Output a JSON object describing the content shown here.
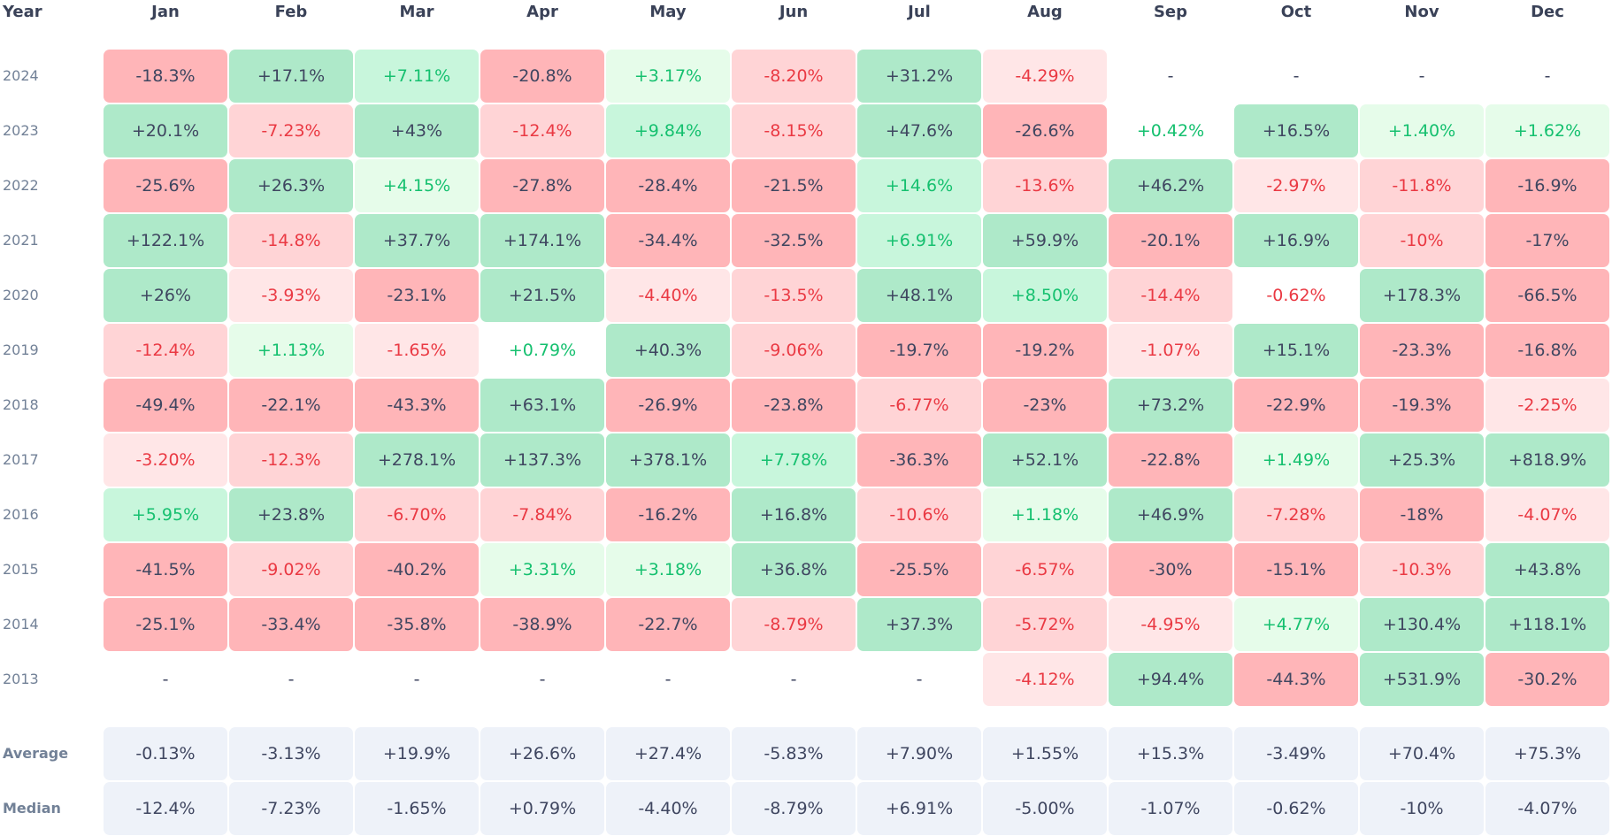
{
  "chart_data": {
    "type": "heatmap",
    "title": "",
    "row_header": "Year",
    "columns": [
      "Jan",
      "Feb",
      "Mar",
      "Apr",
      "May",
      "Jun",
      "Jul",
      "Aug",
      "Sep",
      "Oct",
      "Nov",
      "Dec"
    ],
    "rows": [
      {
        "label": "2024",
        "values": [
          "-18.3%",
          "+17.1%",
          "+7.11%",
          "-20.8%",
          "+3.17%",
          "-8.20%",
          "+31.2%",
          "-4.29%",
          "-",
          "-",
          "-",
          "-"
        ]
      },
      {
        "label": "2023",
        "values": [
          "+20.1%",
          "-7.23%",
          "+43%",
          "-12.4%",
          "+9.84%",
          "-8.15%",
          "+47.6%",
          "-26.6%",
          "+0.42%",
          "+16.5%",
          "+1.40%",
          "+1.62%"
        ]
      },
      {
        "label": "2022",
        "values": [
          "-25.6%",
          "+26.3%",
          "+4.15%",
          "-27.8%",
          "-28.4%",
          "-21.5%",
          "+14.6%",
          "-13.6%",
          "+46.2%",
          "-2.97%",
          "-11.8%",
          "-16.9%"
        ]
      },
      {
        "label": "2021",
        "values": [
          "+122.1%",
          "-14.8%",
          "+37.7%",
          "+174.1%",
          "-34.4%",
          "-32.5%",
          "+6.91%",
          "+59.9%",
          "-20.1%",
          "+16.9%",
          "-10%",
          "-17%"
        ]
      },
      {
        "label": "2020",
        "values": [
          "+26%",
          "-3.93%",
          "-23.1%",
          "+21.5%",
          "-4.40%",
          "-13.5%",
          "+48.1%",
          "+8.50%",
          "-14.4%",
          "-0.62%",
          "+178.3%",
          "-66.5%"
        ]
      },
      {
        "label": "2019",
        "values": [
          "-12.4%",
          "+1.13%",
          "-1.65%",
          "+0.79%",
          "+40.3%",
          "-9.06%",
          "-19.7%",
          "-19.2%",
          "-1.07%",
          "+15.1%",
          "-23.3%",
          "-16.8%"
        ]
      },
      {
        "label": "2018",
        "values": [
          "-49.4%",
          "-22.1%",
          "-43.3%",
          "+63.1%",
          "-26.9%",
          "-23.8%",
          "-6.77%",
          "-23%",
          "+73.2%",
          "-22.9%",
          "-19.3%",
          "-2.25%"
        ]
      },
      {
        "label": "2017",
        "values": [
          "-3.20%",
          "-12.3%",
          "+278.1%",
          "+137.3%",
          "+378.1%",
          "+7.78%",
          "-36.3%",
          "+52.1%",
          "-22.8%",
          "+1.49%",
          "+25.3%",
          "+818.9%"
        ]
      },
      {
        "label": "2016",
        "values": [
          "+5.95%",
          "+23.8%",
          "-6.70%",
          "-7.84%",
          "-16.2%",
          "+16.8%",
          "-10.6%",
          "+1.18%",
          "+46.9%",
          "-7.28%",
          "-18%",
          "-4.07%"
        ]
      },
      {
        "label": "2015",
        "values": [
          "-41.5%",
          "-9.02%",
          "-40.2%",
          "+3.31%",
          "+3.18%",
          "+36.8%",
          "-25.5%",
          "-6.57%",
          "-30%",
          "-15.1%",
          "-10.3%",
          "+43.8%"
        ]
      },
      {
        "label": "2014",
        "values": [
          "-25.1%",
          "-33.4%",
          "-35.8%",
          "-38.9%",
          "-22.7%",
          "-8.79%",
          "+37.3%",
          "-5.72%",
          "-4.95%",
          "+4.77%",
          "+130.4%",
          "+118.1%"
        ]
      },
      {
        "label": "2013",
        "values": [
          "-",
          "-",
          "-",
          "-",
          "-",
          "-",
          "-",
          "-4.12%",
          "+94.4%",
          "-44.3%",
          "+531.9%",
          "-30.2%"
        ]
      }
    ],
    "summary_rows": [
      {
        "label": "Average",
        "values": [
          "-0.13%",
          "-3.13%",
          "+19.9%",
          "+26.6%",
          "+27.4%",
          "-5.83%",
          "+7.90%",
          "+1.55%",
          "+15.3%",
          "-3.49%",
          "+70.4%",
          "+75.3%"
        ]
      },
      {
        "label": "Median",
        "values": [
          "-12.4%",
          "-7.23%",
          "-1.65%",
          "+0.79%",
          "-4.40%",
          "-8.79%",
          "+6.91%",
          "-5.00%",
          "-1.07%",
          "-0.62%",
          "-10%",
          "-4.07%"
        ]
      }
    ],
    "color_scale": {
      "positive_strong": "#aee9c9",
      "positive_medium": "#c8f6dc",
      "positive_light": "#e6fcea",
      "negative_strong": "#ffb5b8",
      "negative_medium": "#ffd4d6",
      "negative_light": "#ffe6e7",
      "summary": "#eef2f9",
      "positive_text": "#15c06f",
      "negative_text": "#ea3943",
      "neutral_text": "#3f4660"
    }
  }
}
